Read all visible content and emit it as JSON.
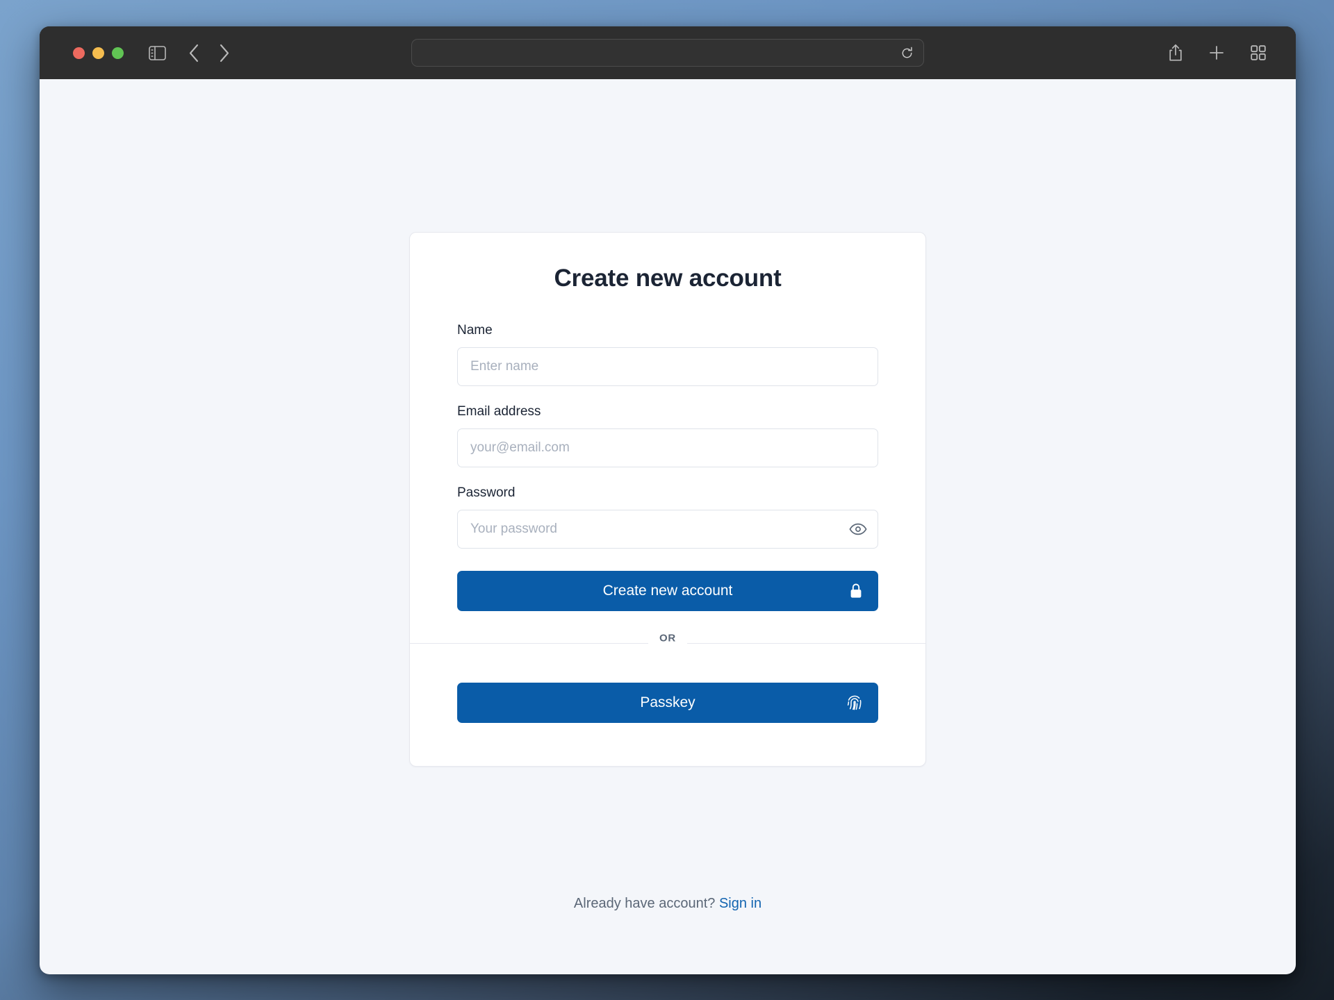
{
  "desktop": {
    "background_top": "#7ba3cc",
    "background_bottom": "#171f28"
  },
  "browser": {
    "traffic_lights": {
      "close_label": "Close",
      "minimize_label": "Minimize",
      "zoom_label": "Zoom",
      "close_color": "#ed6a5f",
      "minimize_color": "#f5bd4f",
      "zoom_color": "#61c454"
    },
    "sidebar_toggle_label": "Show sidebar",
    "back_label": "Back",
    "forward_label": "Forward",
    "address_bar": {
      "value": "",
      "placeholder": "",
      "reload_label": "Reload"
    },
    "share_label": "Share",
    "new_tab_label": "New Tab",
    "tab_overview_label": "Tab Overview"
  },
  "page": {
    "background": "#f4f6fa",
    "card": {
      "title": "Create new account",
      "fields": [
        {
          "label": "Name",
          "placeholder": "Enter name",
          "value": "",
          "type": "text"
        },
        {
          "label": "Email address",
          "placeholder": "your@email.com",
          "value": "",
          "type": "email"
        },
        {
          "label": "Password",
          "placeholder": "Your password",
          "value": "",
          "type": "password"
        }
      ],
      "submit_label": "Create new account",
      "submit_icon": "lock-icon",
      "divider_label": "OR",
      "passkey_label": "Passkey",
      "passkey_icon": "fingerprint-icon",
      "password_toggle_icon": "eye-icon",
      "accent_color": "#0a5ca8"
    },
    "footer": {
      "text": "Already have account?",
      "link_label": "Sign in",
      "link_color": "#1264b0"
    }
  }
}
